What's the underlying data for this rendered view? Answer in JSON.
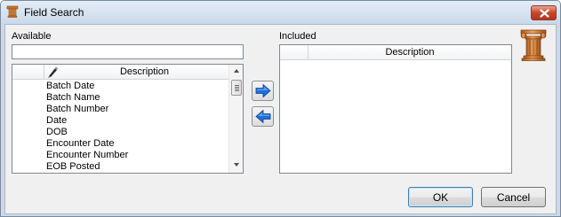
{
  "window": {
    "title": "Field Search"
  },
  "available": {
    "label": "Available",
    "search_value": "",
    "column_header": "Description",
    "items": [
      "Batch Date",
      "Batch Name",
      "Batch Number",
      "Date",
      "DOB",
      "Encounter Date",
      "Encounter Number",
      "EOB Posted"
    ]
  },
  "included": {
    "label": "Included",
    "column_header": "Description",
    "items": []
  },
  "buttons": {
    "ok": "OK",
    "cancel": "Cancel"
  },
  "icons": {
    "title": "column-icon",
    "logo": "column-icon",
    "close": "close-icon",
    "add": "arrow-right-icon",
    "remove": "arrow-left-icon",
    "header": "pencil-icon"
  },
  "colors": {
    "arrow_blue": "#1e6fd9",
    "column_orange": "#c8742e",
    "close_red": "#c7462a"
  }
}
